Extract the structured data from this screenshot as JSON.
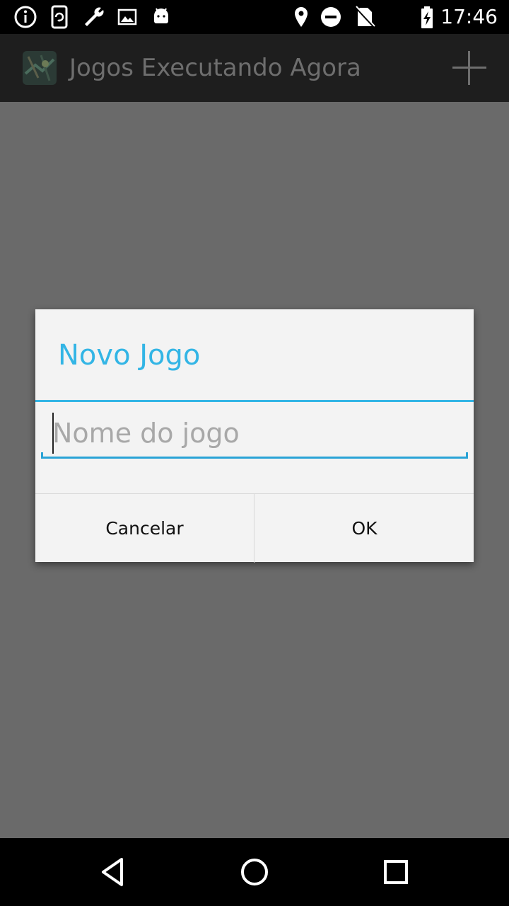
{
  "status_bar": {
    "time": "17:46",
    "left_icons": [
      "info-icon",
      "phone-sync-icon",
      "wrench-icon",
      "image-icon",
      "android-icon"
    ],
    "right_icons": [
      "location-icon",
      "do-not-disturb-icon",
      "no-sim-icon",
      "battery-icon"
    ]
  },
  "action_bar": {
    "title": "Jogos Executando Agora",
    "app_icon": "app-map-icon",
    "action_icon": "plus-icon"
  },
  "dialog": {
    "title": "Novo Jogo",
    "input": {
      "value": "",
      "placeholder": "Nome do jogo"
    },
    "buttons": {
      "cancel_label": "Cancelar",
      "ok_label": "OK"
    }
  },
  "colors": {
    "accent": "#33b5e5",
    "dim_background": "#6a6a6a",
    "dialog_background": "#f3f3f3"
  },
  "nav_bar": {
    "icons": [
      "back-icon",
      "home-icon",
      "recents-icon"
    ]
  }
}
